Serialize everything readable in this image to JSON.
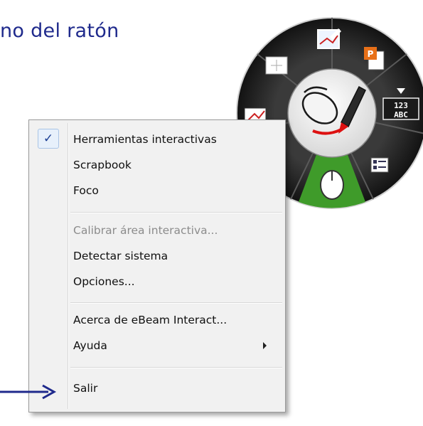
{
  "heading": "no del ratón",
  "menu": {
    "items": [
      {
        "label": "Herramientas interactivas",
        "checked": true,
        "enabled": true
      },
      {
        "label": "Scrapbook",
        "enabled": true
      },
      {
        "label": "Foco",
        "enabled": true
      },
      {
        "label": "Calibrar área interactiva...",
        "enabled": false
      },
      {
        "label": "Detectar sistema",
        "enabled": true
      },
      {
        "label": "Opciones...",
        "enabled": true
      },
      {
        "label": "Acerca de eBeam Interact...",
        "enabled": true
      },
      {
        "label": "Ayuda",
        "enabled": true,
        "submenu": true
      },
      {
        "label": "Salir",
        "enabled": true
      }
    ],
    "check_glyph": "✓"
  },
  "wheel": {
    "tools": [
      "cursor-icon",
      "pen-annotate-icon",
      "presentation-icon",
      "keyboard-abc-icon",
      "list-icon",
      "mouse-icon",
      "screen-annotate-icon"
    ],
    "keyboard_top": "123",
    "keyboard_bottom": "ABC"
  },
  "colors": {
    "heading": "#1f2a8c",
    "arrow": "#1f2a8c",
    "wheel_dark": "#2b2b2b",
    "wheel_active": "#3f9b2a"
  }
}
